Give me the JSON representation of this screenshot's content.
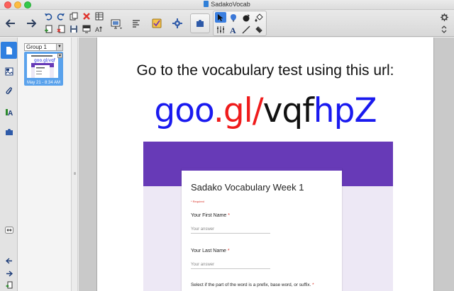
{
  "window": {
    "title": "SadakoVocab"
  },
  "sorter": {
    "group_label": "Group 1",
    "thumb_caption": "May 21 - 8:34 AM"
  },
  "page": {
    "heading": "Go to the vocabulary test using this url:",
    "url_parts": [
      {
        "text": "goo",
        "color": "#1a1aef"
      },
      {
        "text": ".",
        "color": "#ef1b1b"
      },
      {
        "text": "gl",
        "color": "#ef1b1b"
      },
      {
        "text": "/",
        "color": "#ef1b1b"
      },
      {
        "text": "vqf",
        "color": "#111111"
      },
      {
        "text": "hpZ",
        "color": "#1a1aef"
      }
    ]
  },
  "form_screenshot": {
    "title": "Sadako Vocabulary Week 1",
    "required_note": "* Required",
    "questions": [
      {
        "label": "Your First Name",
        "required": "*",
        "placeholder": "Your answer"
      },
      {
        "label": "Your Last Name",
        "required": "*",
        "placeholder": "Your answer"
      },
      {
        "label": "Select if the part of the word is a prefix, base word, or suffix.",
        "required": "*"
      }
    ],
    "accent_color": "#673ab7"
  },
  "icons": {
    "toolbar": [
      "back-arrow-icon",
      "forward-arrow-icon",
      "undo-icon",
      "redo-icon",
      "duplicate-icon",
      "delete-icon",
      "table-icon",
      "add-page-icon",
      "save-icon",
      "cut-icon",
      "screen-shade-icon",
      "text-size-icon",
      "document-camera-icon",
      "properties-icon",
      "clipboard-check-icon",
      "gear-tool-icon",
      "puzzle-icon",
      "select-arrow-icon",
      "pen-icon",
      "shape-fill-icon",
      "fill-bucket-icon",
      "adjust-sliders-icon",
      "text-tool-icon",
      "line-tool-icon",
      "eraser-icon",
      "settings-gear-icon",
      "expand-icon"
    ],
    "rail": [
      "page-sorter-icon",
      "gallery-icon",
      "attachments-icon",
      "properties-icon",
      "addons-icon"
    ]
  }
}
